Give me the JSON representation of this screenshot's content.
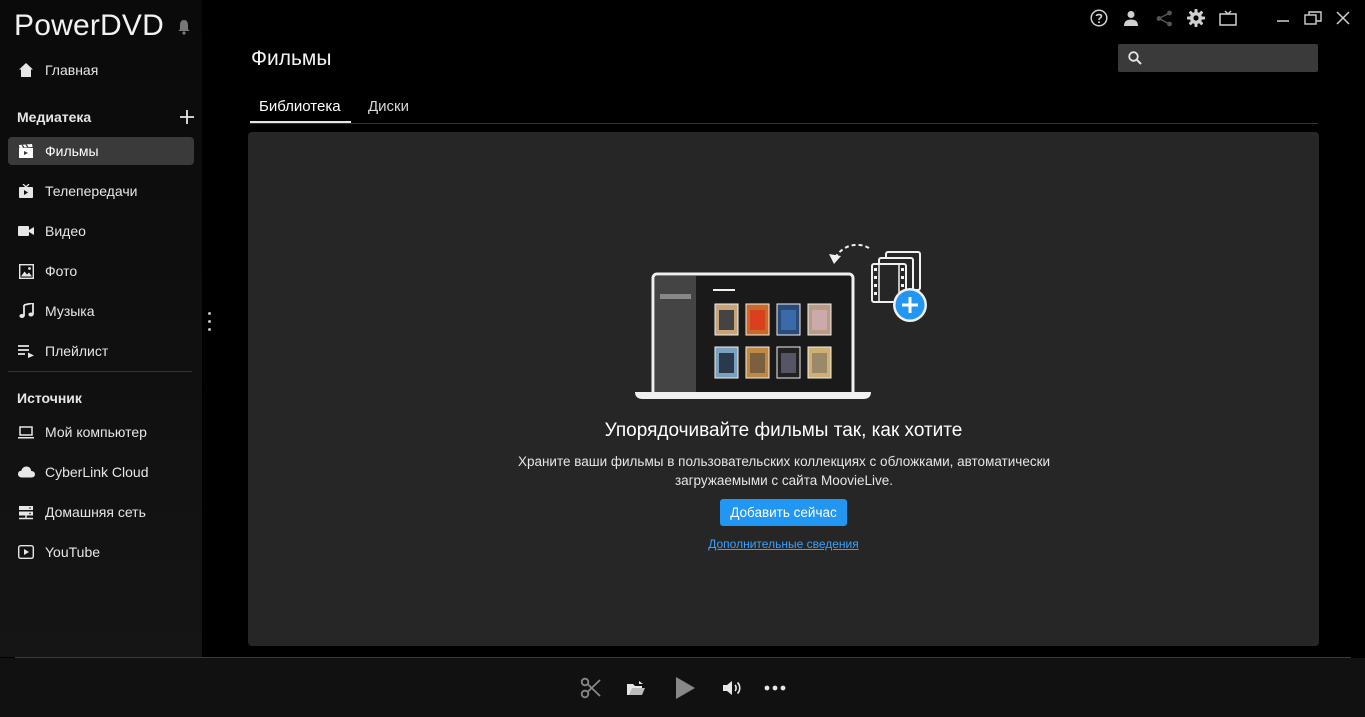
{
  "app": {
    "title": "PowerDVD"
  },
  "sidebar": {
    "home": {
      "label": "Главная",
      "icon": "home-icon"
    },
    "library_header": "Медиатека",
    "library_items": [
      {
        "label": "Фильмы",
        "icon": "movie-clapper-icon",
        "active": true
      },
      {
        "label": "Телепередачи",
        "icon": "tv-icon",
        "active": false
      },
      {
        "label": "Видео",
        "icon": "video-camera-icon",
        "active": false
      },
      {
        "label": "Фото",
        "icon": "photo-icon",
        "active": false
      },
      {
        "label": "Музыка",
        "icon": "music-note-icon",
        "active": false
      },
      {
        "label": "Плейлист",
        "icon": "playlist-icon",
        "active": false
      }
    ],
    "source_header": "Источник",
    "source_items": [
      {
        "label": "Мой компьютер",
        "icon": "laptop-icon"
      },
      {
        "label": "CyberLink Cloud",
        "icon": "cloud-icon"
      },
      {
        "label": "Домашняя сеть",
        "icon": "home-network-icon"
      },
      {
        "label": "YouTube",
        "icon": "youtube-icon"
      }
    ]
  },
  "topbar": {
    "icons": [
      "help-icon",
      "account-icon",
      "share-icon",
      "settings-icon",
      "tv-mode-icon",
      "minimize-icon",
      "restore-icon",
      "close-icon"
    ]
  },
  "main": {
    "title": "Фильмы",
    "search": {
      "placeholder": "",
      "value": ""
    },
    "tabs": [
      {
        "label": "Библиотека",
        "active": true
      },
      {
        "label": "Диски",
        "active": false
      }
    ],
    "empty": {
      "title": "Упорядочивайте фильмы так, как хотите",
      "description": "Храните ваши фильмы в пользовательских коллекциях с обложками, автоматически загружаемыми с сайта MoovieLive.",
      "add_button": "Добавить сейчас",
      "more_link": "Дополнительные сведения"
    }
  },
  "player": {
    "controls": [
      "scissors-icon",
      "open-folder-icon",
      "play-icon",
      "volume-icon",
      "more-icon"
    ]
  },
  "colors": {
    "accent": "#2196f3",
    "panel": "#262626",
    "active_nav": "#3a3a3a"
  }
}
